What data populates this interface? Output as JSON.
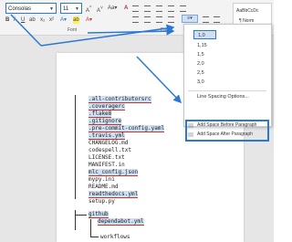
{
  "ribbon": {
    "font_name": "Consolas",
    "font_size": "11",
    "groups": {
      "font": "Font",
      "paragraph": "Parag"
    },
    "styles": {
      "sample": "AaBbCcDc",
      "name": "¶ Norm"
    }
  },
  "line_spacing_menu": {
    "options": [
      "1,0",
      "1,15",
      "1,5",
      "2,0",
      "2,5",
      "3,0"
    ],
    "selected": "1,0",
    "more": "Line Spacing Options...",
    "add_before": "Add Space Before Paragraph",
    "add_after": "Add Space After Paragraph"
  },
  "document": {
    "lines": [
      ".all-contributorsrc",
      ".coveragerc",
      ".flake8",
      ".gitignore",
      ".pre-commit-config.yaml",
      ".travis.yml",
      "CHANGELOG.md",
      "codespell.txt",
      "LICENSE.txt",
      "MANIFEST.in",
      "mlc_config.json",
      "mypy.ini",
      "README.md",
      "readthedocs.yml",
      "setup.py",
      "github",
      "dependabot.yml",
      "workflows"
    ]
  },
  "colors": {
    "accent": "#2b78d4",
    "highlight": "#cfe0f5",
    "underline": "#c0392b"
  }
}
